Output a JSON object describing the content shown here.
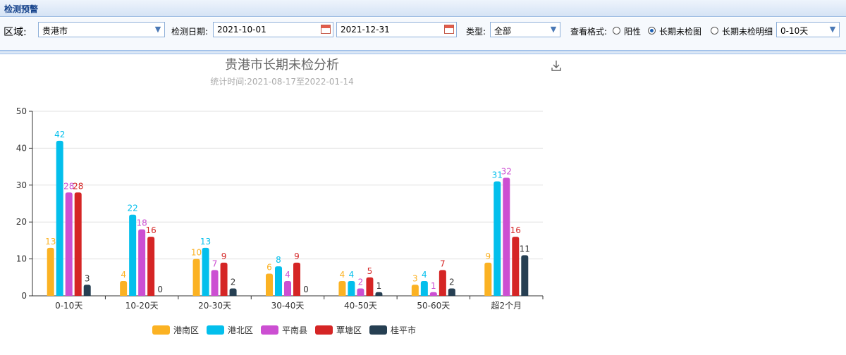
{
  "window": {
    "title": "检测预警"
  },
  "filters": {
    "region_label": "区域:",
    "region_value": "贵港市",
    "date_label": "检测日期:",
    "start_date": "2021-10-01",
    "end_date": "2021-12-31",
    "type_label": "类型:",
    "type_value": "全部",
    "view_label": "查看格式:",
    "view_options": [
      "阳性",
      "长期未检图",
      "长期未检明细"
    ],
    "view_selected": "长期未检图",
    "range_value": "0-10天"
  },
  "chart_data": {
    "type": "bar",
    "title": "贵港市长期未检分析",
    "subtitle": "统计时间:2021-08-17至2022-01-14",
    "categories": [
      "0-10天",
      "10-20天",
      "20-30天",
      "30-40天",
      "40-50天",
      "50-60天",
      "超2个月"
    ],
    "ylim": [
      0,
      50
    ],
    "yticks": [
      0,
      10,
      20,
      30,
      40,
      50
    ],
    "grid": true,
    "legend_position": "bottom-center",
    "series": [
      {
        "name": "港南区",
        "color": "#fbb223",
        "values": [
          13,
          4,
          10,
          6,
          4,
          3,
          9
        ]
      },
      {
        "name": "港北区",
        "color": "#03bfec",
        "values": [
          42,
          22,
          13,
          8,
          4,
          4,
          31
        ]
      },
      {
        "name": "平南县",
        "color": "#cc4fd2",
        "values": [
          28,
          18,
          7,
          4,
          2,
          1,
          32
        ]
      },
      {
        "name": "覃塘区",
        "color": "#d52525",
        "values": [
          28,
          16,
          9,
          9,
          5,
          7,
          16
        ]
      },
      {
        "name": "桂平市",
        "color": "#263f52",
        "values": [
          3,
          0,
          2,
          0,
          1,
          2,
          11
        ]
      }
    ]
  }
}
